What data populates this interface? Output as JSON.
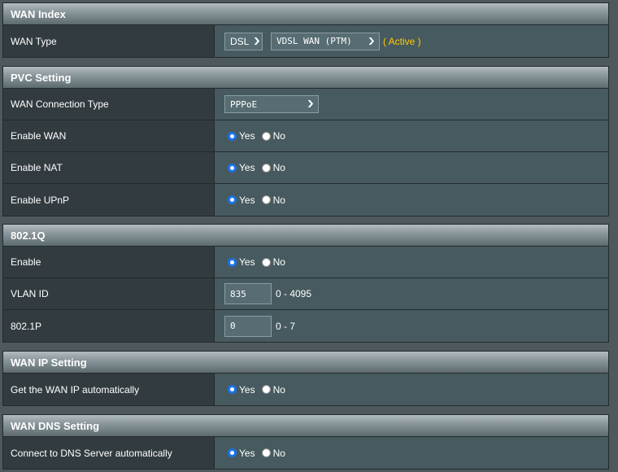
{
  "wan_index": {
    "title": "WAN Index",
    "wan_type_label": "WAN Type",
    "dsl_select": "DSL",
    "vdsl_select": "VDSL WAN (PTM)",
    "status": "( Active )"
  },
  "pvc_setting": {
    "title": "PVC Setting",
    "connection_type_label": "WAN Connection Type",
    "connection_type_value": "PPPoE",
    "enable_wan_label": "Enable WAN",
    "enable_nat_label": "Enable NAT",
    "enable_upnp_label": "Enable UPnP"
  },
  "dot1q": {
    "title": "802.1Q",
    "enable_label": "Enable",
    "vlan_id_label": "VLAN ID",
    "vlan_id_value": "835",
    "vlan_id_range": "0 - 4095",
    "priority_label": "802.1P",
    "priority_value": "0",
    "priority_range": "0 - 7"
  },
  "wan_ip": {
    "title": "WAN IP Setting",
    "auto_ip_label": "Get the WAN IP automatically"
  },
  "wan_dns": {
    "title": "WAN DNS Setting",
    "auto_dns_label": "Connect to DNS Server automatically"
  },
  "radio": {
    "yes": "Yes",
    "no": "No"
  },
  "colors": {
    "active_status": "#ffcc00",
    "radio_checked": "#1a73e8"
  }
}
